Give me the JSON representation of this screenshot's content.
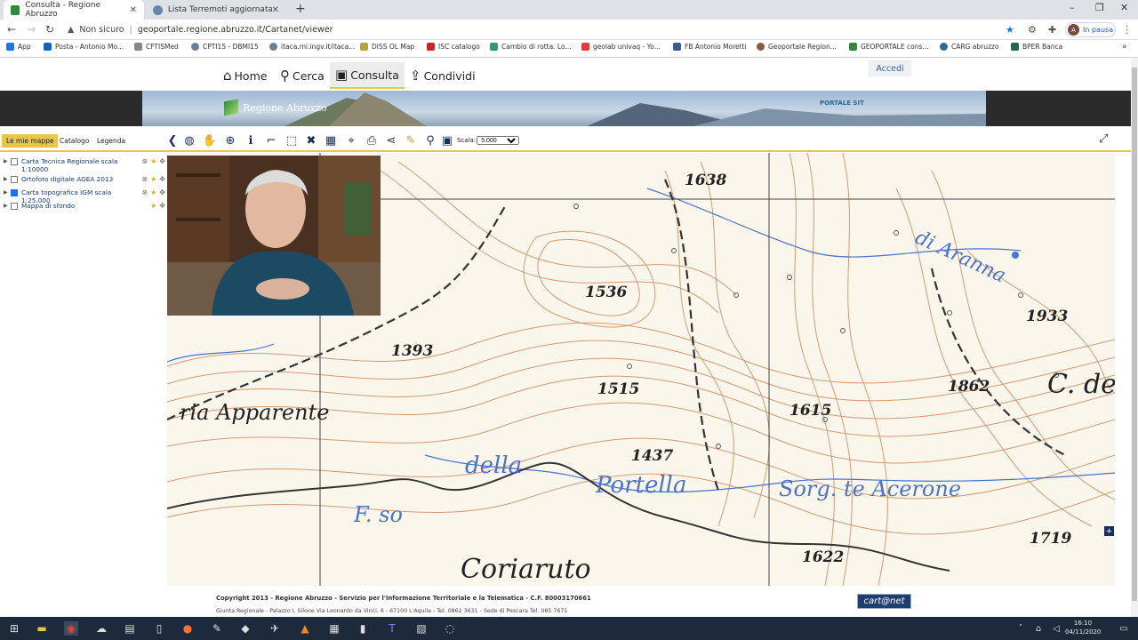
{
  "browser": {
    "tabs": [
      {
        "title": "Consulta - Regione Abruzzo",
        "active": true
      },
      {
        "title": "Lista Terremoti aggiornata in tem",
        "active": false
      }
    ],
    "address": {
      "security": "Non sicuro",
      "url": "geoportale.regione.abruzzo.it/Cartanet/viewer"
    },
    "profile_status": "In pausa",
    "profile_initial": "A",
    "bookmarks": [
      "App",
      "Posta - Antonio Mo...",
      "CFTISMed",
      "CPTI15 - DBMI15",
      "itaca.mi.ingv.it/itaca...",
      "DISS OL Map",
      "ISC catalogo",
      "Cambio di rotta. Lo...",
      "geolab univaq - Yo...",
      "FB Antonio Moretti",
      "Geoportale Region...",
      "GEOPORTALE cons...",
      "CARG abruzzo",
      "BPER Banca"
    ]
  },
  "site": {
    "nav": [
      "Home",
      "Cerca",
      "Consulta",
      "Condividi"
    ],
    "login": "Accedi",
    "banner_title": "Regione Abruzzo",
    "banner_portal": "PORTALE SIT"
  },
  "panel_tabs": [
    "Le mie mappe",
    "Catalogo",
    "Legenda"
  ],
  "scale": {
    "label": "Scala:",
    "value": "5.000"
  },
  "layers": [
    {
      "name": "Carta Tecnica Regionale scala 1:10000",
      "checked": false
    },
    {
      "name": "Ortofoto digitale AGEA 2013",
      "checked": false
    },
    {
      "name": "Carta topografica IGM scala 1:25.000",
      "checked": true
    },
    {
      "name": "Mappa di sfondo",
      "checked": false
    }
  ],
  "map": {
    "elevations": [
      "1638",
      "1536",
      "1393",
      "1515",
      "1933",
      "1862",
      "1615",
      "1437",
      "1719",
      "1622"
    ],
    "place_labels": [
      "ria Apparente",
      "della",
      "Portella",
      "Sorg. te Acerone",
      "Coriaruto",
      "di Aranna",
      "C. de",
      "F. so"
    ]
  },
  "footer": {
    "line1": "Copyright 2013 - Regione Abruzzo - Servizio per l'Informazione Territoriale e la Telematica - C.F. 80003170661",
    "line2": "Giunta Regionale - Palazzo I. Silone Via Leonardo da Vinci, 6 - 67100 L'Aquila - Tel. 0862 3631 - Sede di Pescara Tel. 085 7671",
    "brand": "cart@net"
  },
  "taskbar": {
    "time": "16:10",
    "date": "04/11/2020"
  },
  "colors": {
    "accent_yellow": "#e8c64a",
    "map_contour": "#c47a4a",
    "map_water": "#4a73c9"
  }
}
